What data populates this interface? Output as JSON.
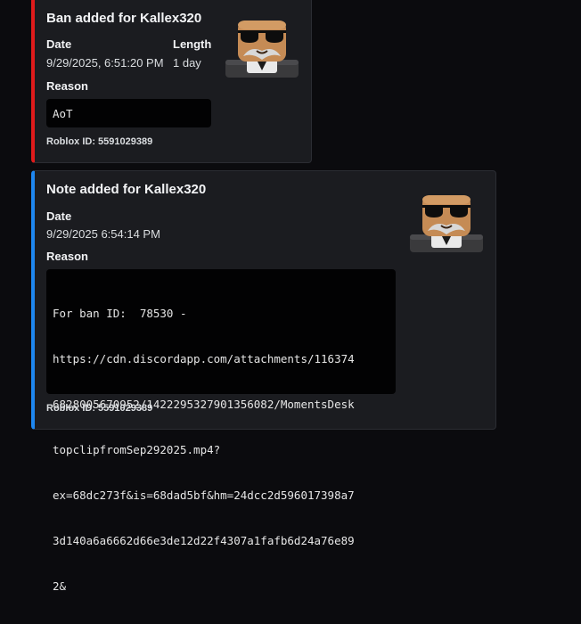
{
  "ban_embed": {
    "accent_color": "#e01b1b",
    "title": "Ban added for Kallex320",
    "date_label": "Date",
    "date_value": "9/29/2025, 6:51:20 PM",
    "length_label": "Length",
    "length_value": "1 day",
    "reason_label": "Reason",
    "reason_value": "AoT",
    "footer": "Roblox ID: 5591029389",
    "thumbnail_icon": "roblox-avatar-thumbnail"
  },
  "note_embed": {
    "accent_color": "#1e87f0",
    "title": "Note added for Kallex320",
    "date_label": "Date",
    "date_value": "9/29/2025 6:54:14 PM",
    "reason_label": "Reason",
    "reason_lines": [
      "For ban ID:  78530 -",
      "https://cdn.discordapp.com/attachments/116374",
      "6828005670952/1422295327901356082/MomentsDesk",
      "topclipfromSep292025.mp4?",
      "ex=68dc273f&is=68dad5bf&hm=24dcc2d596017398a7",
      "3d140a6a6662d66e3de12d22f4307a1fafb6d24a76e89",
      "2&"
    ],
    "footer": "Roblox ID: 5591029389",
    "thumbnail_icon": "roblox-avatar-thumbnail"
  }
}
